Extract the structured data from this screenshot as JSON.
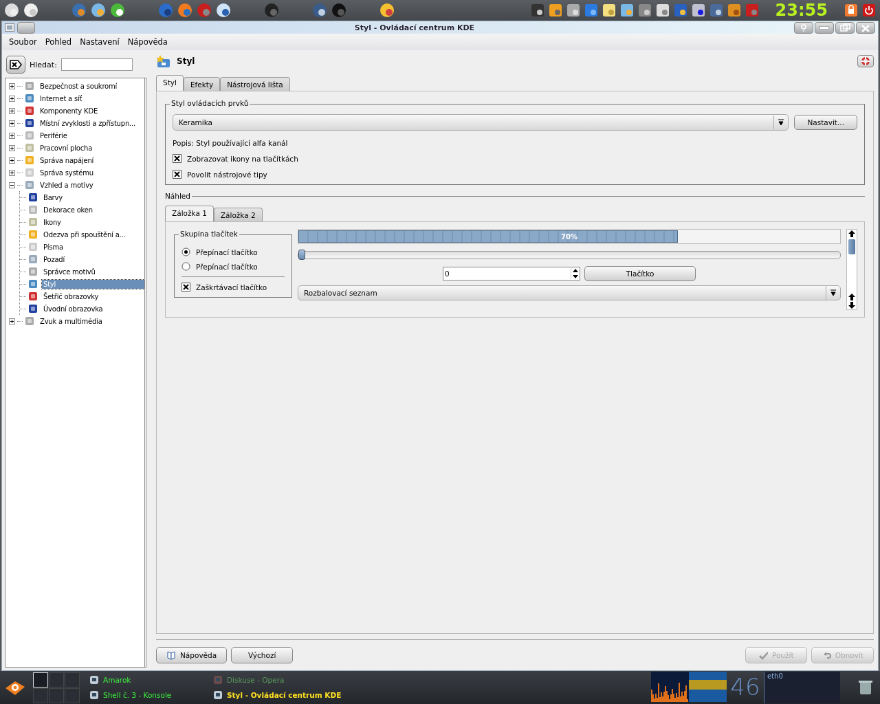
{
  "panel": {
    "clock": "23:55"
  },
  "window": {
    "title": "Styl - Ovládací centrum KDE"
  },
  "menu": [
    "Soubor",
    "Pohled",
    "Nastavení",
    "Nápověda"
  ],
  "search": {
    "label": "Hledat:"
  },
  "tree": [
    {
      "label": "Bezpečnost a soukromí",
      "expanded": false,
      "selected": false
    },
    {
      "label": "Internet a síť",
      "expanded": false,
      "selected": false
    },
    {
      "label": "Komponenty KDE",
      "expanded": false,
      "selected": false
    },
    {
      "label": "Místní zvyklosti a zpřístupn...",
      "expanded": false,
      "selected": false
    },
    {
      "label": "Periférie",
      "expanded": false,
      "selected": false
    },
    {
      "label": "Pracovní plocha",
      "expanded": false,
      "selected": false
    },
    {
      "label": "Správa napájení",
      "expanded": false,
      "selected": false
    },
    {
      "label": "Správa systému",
      "expanded": false,
      "selected": false
    },
    {
      "label": "Vzhled a motivy",
      "expanded": true,
      "selected": false,
      "children": [
        {
          "label": "Barvy",
          "selected": false
        },
        {
          "label": "Dekorace oken",
          "selected": false
        },
        {
          "label": "Ikony",
          "selected": false
        },
        {
          "label": "Odezva při spouštění a...",
          "selected": false
        },
        {
          "label": "Písma",
          "selected": false
        },
        {
          "label": "Pozadí",
          "selected": false
        },
        {
          "label": "Správce motivů",
          "selected": false
        },
        {
          "label": "Styl",
          "selected": true
        },
        {
          "label": "Šetřič obrazovky",
          "selected": false
        },
        {
          "label": "Úvodní obrazovka",
          "selected": false
        }
      ]
    },
    {
      "label": "Zvuk a multimédia",
      "expanded": false,
      "selected": false
    }
  ],
  "module": {
    "title": "Styl"
  },
  "tabs": [
    {
      "label": "Styl",
      "selected": true
    },
    {
      "label": "Efekty",
      "selected": false
    },
    {
      "label": "Nástrojová lišta",
      "selected": false
    }
  ],
  "style_group": {
    "title": "Styl ovládacích prvků",
    "combo": "Keramika",
    "configure": "Nastavit...",
    "description": "Popis: Styl používající alfa kanál",
    "options": [
      {
        "label": "Zobrazovat ikony na tlačítkách",
        "checked": true
      },
      {
        "label": "Povolit nástrojové tipy",
        "checked": true
      }
    ]
  },
  "preview": {
    "title": "Náhled",
    "tabs": [
      {
        "label": "Záložka 1",
        "selected": true
      },
      {
        "label": "Záložka 2",
        "selected": false
      }
    ],
    "group": {
      "title": "Skupina tlačítek",
      "items": [
        {
          "kind": "radio",
          "label": "Přepínací tlačítko",
          "checked": true
        },
        {
          "kind": "radio",
          "label": "Přepínací tlačítko",
          "checked": false
        },
        {
          "kind": "checkbox",
          "label": "Zaškrtávací tlačítko",
          "checked": true
        }
      ]
    },
    "progress": {
      "level": 0.7,
      "text": "70%"
    },
    "slider": {
      "level": 0
    },
    "spinbox": "0",
    "button": "Tlačítko",
    "combo": "Rozbalovací seznam"
  },
  "buttons": [
    {
      "kind": "help",
      "label": "Nápověda",
      "disabled": false
    },
    {
      "kind": "defaults",
      "label": "Výchozí",
      "disabled": false
    },
    {
      "kind": "apply",
      "label": "Použít",
      "disabled": true
    },
    {
      "kind": "reset",
      "label": "Obnovit",
      "disabled": true
    }
  ],
  "taskbar": {
    "pager": [
      {
        "selected": true
      },
      {
        "selected": false
      },
      {
        "selected": false
      },
      {
        "selected": false
      },
      {
        "selected": false
      },
      {
        "selected": false
      }
    ],
    "tasks": [
      {
        "label": "Amarok",
        "active": false,
        "dimmed": false
      },
      {
        "label": "Diskuse - Opera",
        "active": false,
        "dimmed": true
      },
      {
        "label": "Shell č. 3 - Konsole",
        "active": false,
        "dimmed": false
      },
      {
        "label": "Styl - Ovládací centrum KDE",
        "active": true,
        "dimmed": false
      }
    ],
    "cpu": "46",
    "net": "eth0"
  }
}
